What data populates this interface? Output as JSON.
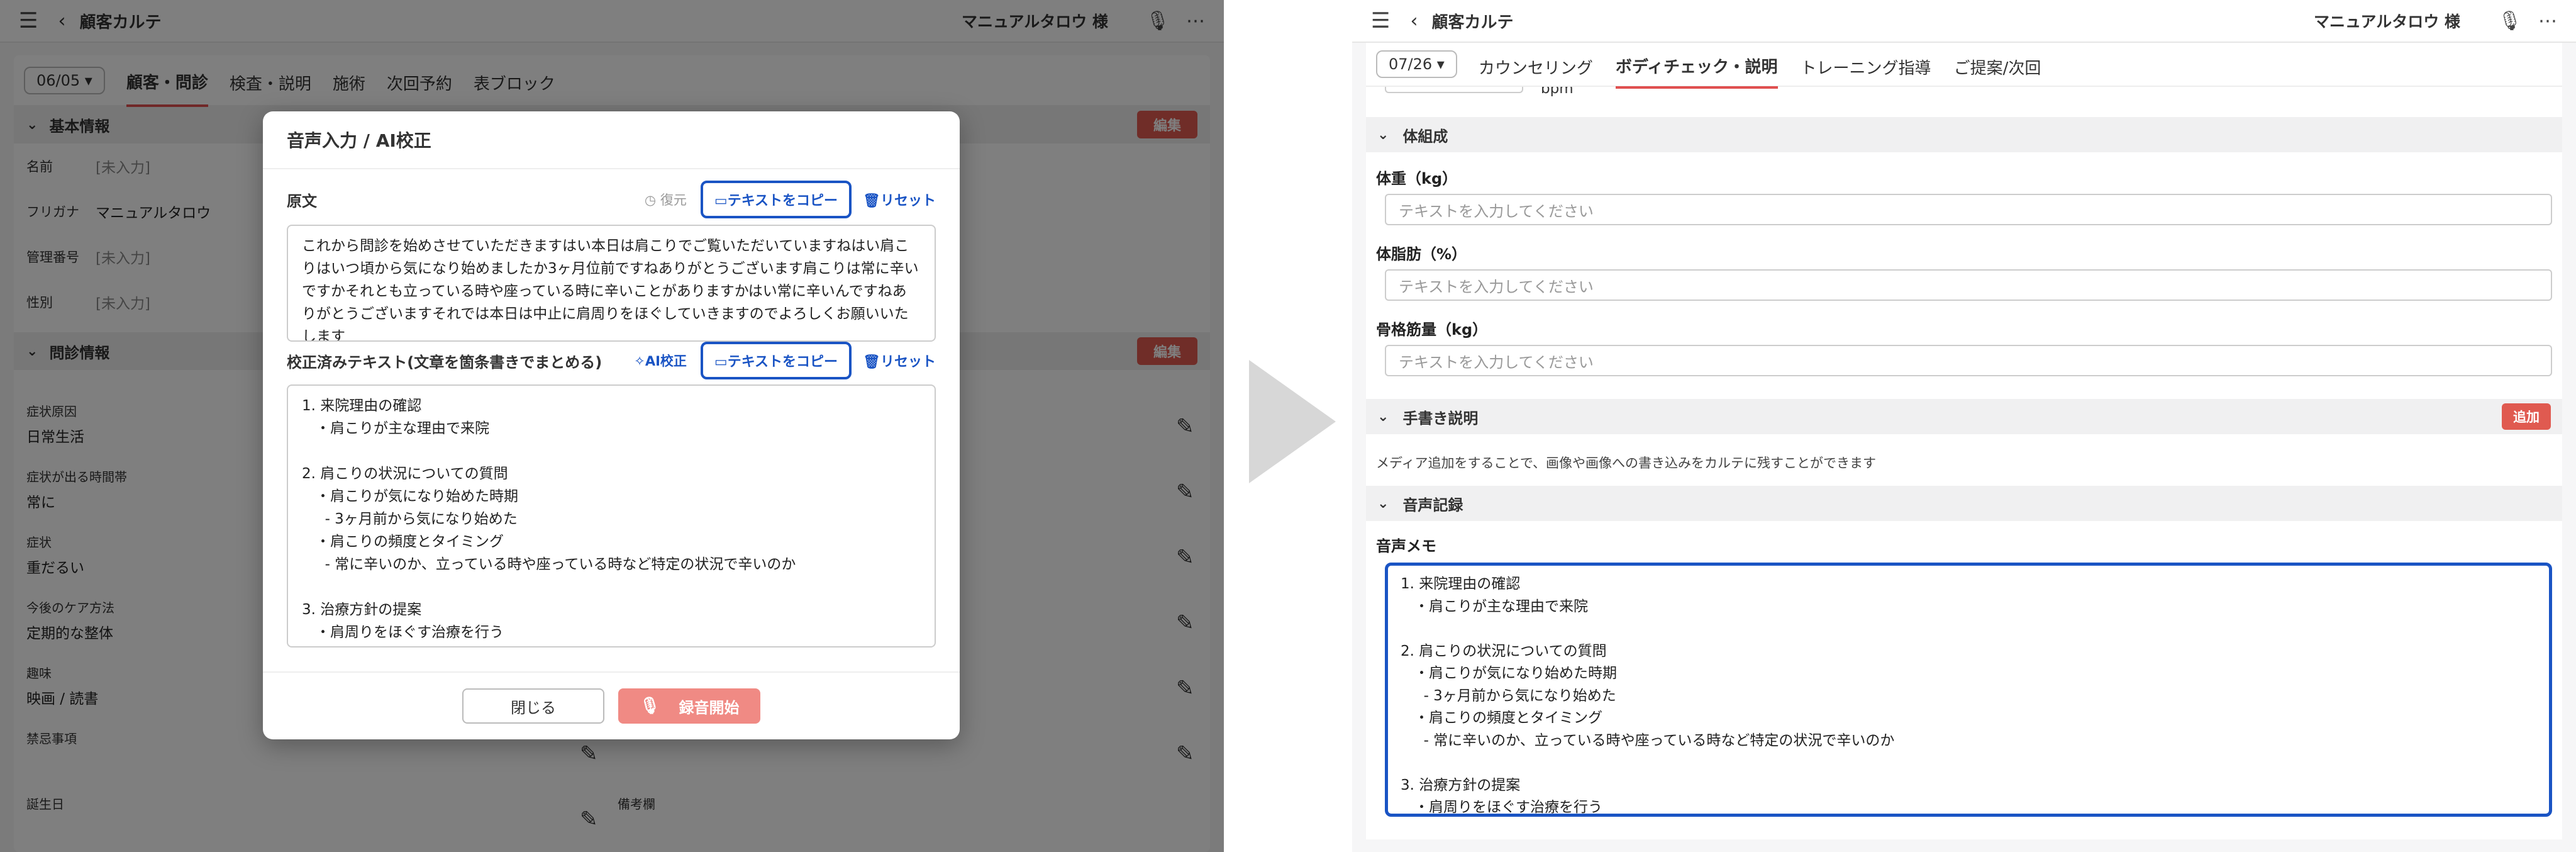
{
  "app": {
    "page_title": "顧客カルテ",
    "user_name": "マニュアルタロウ 様"
  },
  "left": {
    "date": "06/05",
    "tabs": [
      "顧客・問診",
      "検査・説明",
      "施術",
      "次回予約",
      "表ブロック"
    ],
    "basic_section": {
      "title": "基本情報",
      "edit_label": "編集"
    },
    "basic_fields": [
      {
        "label": "名前",
        "value": "[未入力]"
      },
      {
        "label": "フリガナ",
        "value": "マニュアルタロウ"
      },
      {
        "label": "管理番号",
        "value": "[未入力]"
      },
      {
        "label": "性別",
        "value": "[未入力]"
      }
    ],
    "inquiry_section": {
      "title": "問診情報",
      "edit_label": "編集"
    },
    "inquiry_fields": [
      {
        "label": "症状原因",
        "value": "日常生活"
      },
      {
        "label": "症状が出る時間帯",
        "value": "常に"
      },
      {
        "label": "症状",
        "value": "重だるい"
      },
      {
        "label": "今後のケア方法",
        "value": "定期的な整体"
      },
      {
        "label": "趣味",
        "value": "映画 / 読書"
      },
      {
        "label": "禁忌事項",
        "value": ""
      },
      {
        "label": "誕生日",
        "value": ""
      }
    ],
    "extra_field_label": "備考欄"
  },
  "modal": {
    "title": "音声入力 / AI校正",
    "original": {
      "label": "原文",
      "restore_label": "復元",
      "copy_label": "テキストをコピー",
      "reset_label": "リセット",
      "text": "これから問診を始めさせていただきますはい本日は肩こりでご覧いただいていますねはい肩こりはいつ頃から気になり始めましたか3ヶ月位前ですねありがとうございます肩こりは常に辛いですかそれとも立っている時や座っている時に辛いことがありますかはい常に辛いんですねありがとうございますそれでは本日は中止に肩周りをほぐしていきますのでよろしくお願いいたします"
    },
    "corrected": {
      "label": "校正済みテキスト(文章を箇条書きでまとめる)",
      "ai_label": "AI校正",
      "copy_label": "テキストをコピー",
      "reset_label": "リセット",
      "text": "1. 来院理由の確認\n   ・肩こりが主な理由で来院\n\n2. 肩こりの状況についての質問\n   ・肩こりが気になり始めた時期\n     - 3ヶ月前から気になり始めた\n   ・肩こりの頻度とタイミング\n     - 常に辛いのか、立っている時や座っている時など特定の状況で辛いのか\n\n3. 治療方針の提案\n   ・肩周りをほぐす治療を行う"
    },
    "close_label": "閉じる",
    "record_label": "録音開始"
  },
  "right": {
    "date": "07/26",
    "tabs": [
      "カウンセリング",
      "ボディチェック・説明",
      "トレーニング指導",
      "ご提案/次回"
    ],
    "partial_unit": "bpm",
    "body_section": {
      "title": "体組成"
    },
    "fields": [
      {
        "label": "体重（kg）",
        "placeholder": "テキストを入力してください"
      },
      {
        "label": "体脂肪（%）",
        "placeholder": "テキストを入力してください"
      },
      {
        "label": "骨格筋量（kg）",
        "placeholder": "テキストを入力してください"
      }
    ],
    "handwriting_section": {
      "title": "手書き説明",
      "add_label": "追加",
      "note": "メディア追加をすることで、画像や画像への書き込みをカルテに残すことができます"
    },
    "voice_section": {
      "title": "音声記録"
    },
    "memo_label": "音声メモ",
    "memo_text": "1. 来院理由の確認\n   ・肩こりが主な理由で来院\n\n2. 肩こりの状況についての質問\n   ・肩こりが気になり始めた時期\n     - 3ヶ月前から気になり始めた\n   ・肩こりの頻度とタイミング\n     - 常に辛いのか、立っている時や座っている時など特定の状況で辛いのか\n\n3. 治療方針の提案\n   ・肩周りをほぐす治療を行う"
  },
  "colors": {
    "accent_blue": "#1a54c4",
    "accent_red": "#e05a50",
    "record_button": "#f08a84"
  }
}
